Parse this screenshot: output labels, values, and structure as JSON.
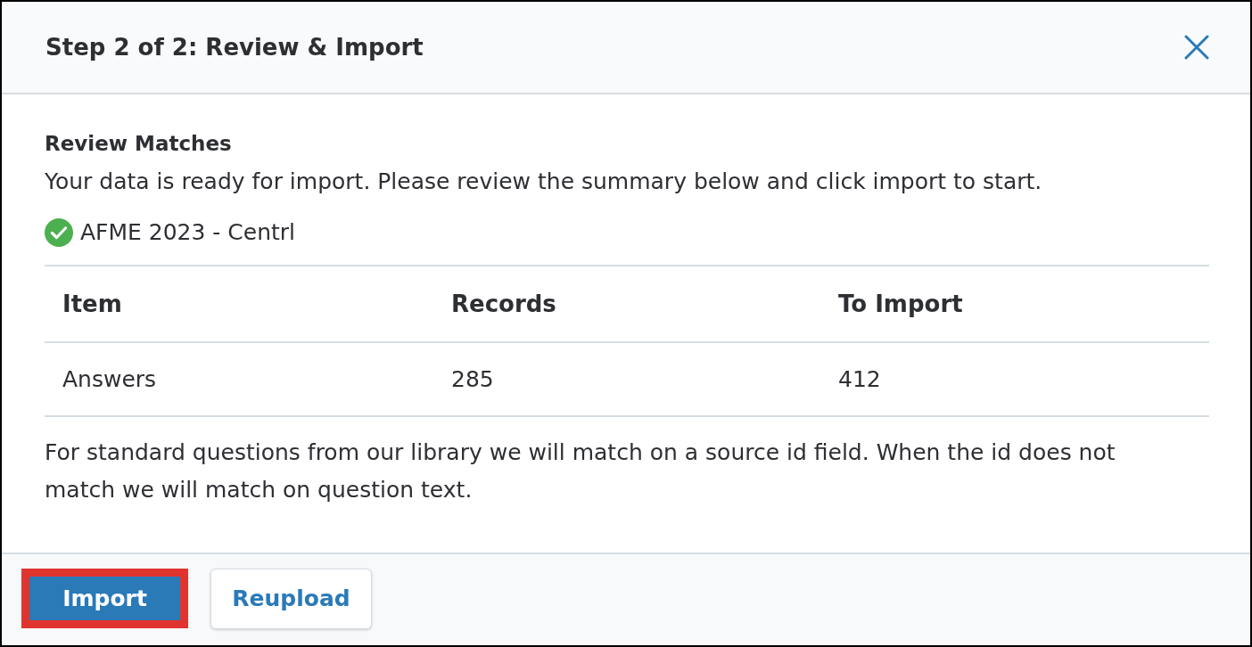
{
  "dialog": {
    "title": "Step 2 of 2: Review & Import"
  },
  "section": {
    "heading": "Review Matches",
    "description": "Your data is ready for import. Please review the summary below and click import to start."
  },
  "source": {
    "name": "AFME 2023 - Centrl"
  },
  "table": {
    "columns": [
      "Item",
      "Records",
      "To Import"
    ],
    "rows": [
      [
        "Answers",
        "285",
        "412"
      ]
    ]
  },
  "note": "For standard questions from our library we will match on a source id field. When the id does not match we will match on question text.",
  "buttons": [
    {
      "label": "Import",
      "kind": "primary",
      "highlighted": true
    },
    {
      "label": "Reupload",
      "kind": "secondary",
      "highlighted": false
    }
  ]
}
